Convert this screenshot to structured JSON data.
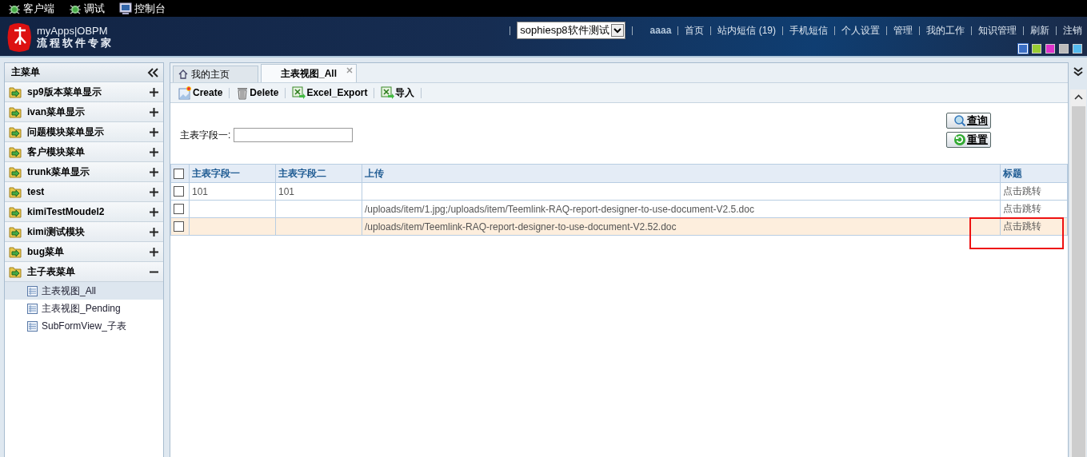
{
  "top_bar": {
    "items": [
      {
        "label": "客户端",
        "kind": "bug"
      },
      {
        "label": "调试",
        "kind": "bug"
      },
      {
        "label": "控制台",
        "kind": "monitor"
      }
    ]
  },
  "header": {
    "logo_title": "myApps|OBPM",
    "logo_subtitle": "流程软件专家",
    "app_select": "sophiesp8软件测试",
    "nav": [
      {
        "label": "aaaa",
        "kind": "user"
      },
      {
        "label": "首页",
        "kind": "link"
      },
      {
        "label": "站内短信 (19)",
        "kind": "link"
      },
      {
        "label": "手机短信",
        "kind": "link"
      },
      {
        "label": "个人设置",
        "kind": "link"
      },
      {
        "label": "管理",
        "kind": "link"
      },
      {
        "label": "我的工作",
        "kind": "link"
      },
      {
        "label": "知识管理",
        "kind": "link"
      },
      {
        "label": "刷新",
        "kind": "link"
      },
      {
        "label": "注销",
        "kind": "link"
      }
    ],
    "themes": [
      {
        "color": "#3b6fc4",
        "selected": true
      },
      {
        "color": "#99cc33",
        "selected": false
      },
      {
        "color": "#dd33cc",
        "selected": false
      },
      {
        "color": "#bbbbbb",
        "selected": false
      },
      {
        "color": "#55bbee",
        "selected": false
      }
    ]
  },
  "sidebar": {
    "title": "主菜单",
    "items": [
      {
        "label": "sp9版本菜单显示",
        "expanded": false
      },
      {
        "label": "ivan菜单显示",
        "expanded": false
      },
      {
        "label": "问题模块菜单显示",
        "expanded": false
      },
      {
        "label": "客户模块菜单",
        "expanded": false
      },
      {
        "label": "trunk菜单显示",
        "expanded": false
      },
      {
        "label": "test",
        "expanded": false
      },
      {
        "label": "kimiTestMoudel2",
        "expanded": false
      },
      {
        "label": "kimi测试模块",
        "expanded": false
      },
      {
        "label": "bug菜单",
        "expanded": false
      },
      {
        "label": "主子表菜单",
        "expanded": true,
        "children": [
          {
            "label": "主表视图_All",
            "selected": true
          },
          {
            "label": "主表视图_Pending",
            "selected": false
          },
          {
            "label": "SubFormView_子表",
            "selected": false
          }
        ]
      }
    ]
  },
  "tabs": [
    {
      "label": "我的主页",
      "selected": false,
      "kind": "home"
    },
    {
      "label": "主表视图_All",
      "selected": true,
      "kind": "view"
    }
  ],
  "toolbar": [
    {
      "label": "Create",
      "kind": "create"
    },
    {
      "label": "Delete",
      "kind": "delete"
    },
    {
      "label": "Excel_Export",
      "kind": "excel"
    },
    {
      "label": "导入",
      "kind": "excel"
    }
  ],
  "search": {
    "label": "主表字段一:",
    "buttons": [
      {
        "label": "查询",
        "kind": "search"
      },
      {
        "label": "重置",
        "kind": "reset"
      }
    ]
  },
  "table": {
    "all_checked": false,
    "columns": [
      "主表字段一",
      "主表字段二",
      "上传",
      "标题"
    ],
    "rows": [
      {
        "checked": false,
        "selected": false,
        "cells": [
          "101",
          "101",
          "",
          "点击跳转"
        ]
      },
      {
        "checked": false,
        "selected": false,
        "cells": [
          "",
          "",
          "/uploads/item/1.jpg;/uploads/item/Teemlink-RAQ-report-designer-to-use-document-V2.5.doc",
          "点击跳转"
        ]
      },
      {
        "checked": false,
        "selected": true,
        "cells": [
          "",
          "",
          "/uploads/item/Teemlink-RAQ-report-designer-to-use-document-V2.52.doc",
          "点击跳转"
        ]
      }
    ]
  },
  "annotation_box": true
}
